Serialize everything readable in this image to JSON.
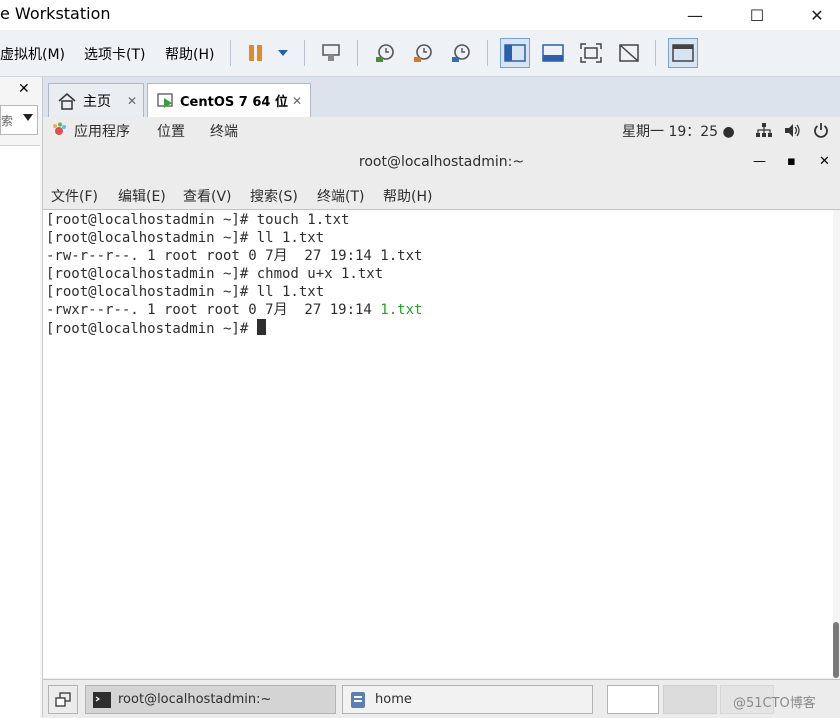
{
  "window": {
    "title": "e Workstation",
    "minimize": "—",
    "maximize": "☐",
    "close": "✕"
  },
  "menubar": {
    "vm": "虚拟机(M)",
    "tabs": "选项卡(T)",
    "help": "帮助(H)"
  },
  "left_panel": {
    "close": "✕",
    "search_text": "索"
  },
  "tabs": [
    {
      "label": "主页",
      "close": "✕"
    },
    {
      "label": "CentOS 7 64 位",
      "close": "✕"
    }
  ],
  "gnome_bar": {
    "applications": "应用程序",
    "places": "位置",
    "terminal": "终端",
    "clock": "星期一 19：25 ●"
  },
  "terminal": {
    "title": "root@localhostadmin:~",
    "controls": {
      "minimize": "—",
      "maximize": "▪",
      "close": "✕"
    },
    "menu": [
      "文件(F)",
      "编辑(E)",
      "查看(V)",
      "搜索(S)",
      "终端(T)",
      "帮助(H)"
    ],
    "lines": [
      "[root@localhostadmin ~]# touch 1.txt",
      "[root@localhostadmin ~]# ll 1.txt",
      "-rw-r--r--. 1 root root 0 7月  27 19:14 1.txt",
      "[root@localhostadmin ~]# chmod u+x 1.txt",
      "[root@localhostadmin ~]# ll 1.txt"
    ],
    "line6_prefix": "-rwxr--r--. 1 root root 0 7月  27 19:14 ",
    "line6_file": "1.txt",
    "prompt": "[root@localhostadmin ~]# "
  },
  "taskbar": {
    "terminal_task": "root@localhostadmin:~",
    "home_task": "home",
    "watermark": "@51CTO博客"
  },
  "colors": {
    "exec_file_green": "#2aa02a",
    "toolbar_accent": "#7aa2cc"
  }
}
